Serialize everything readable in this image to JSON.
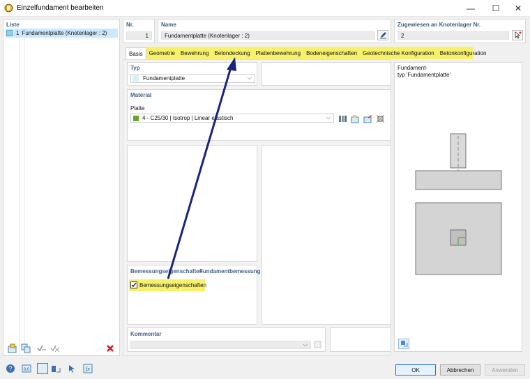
{
  "window": {
    "title": "Einzelfundament bearbeiten",
    "minimize": "—",
    "maximize": "☐",
    "close": "✕"
  },
  "list": {
    "header": "Liste",
    "items": [
      {
        "number": "1",
        "label": "Fundamentplatte (Knotenlager : 2)"
      }
    ]
  },
  "nr": {
    "label": "Nr.",
    "value": "1"
  },
  "name": {
    "label": "Name",
    "value": "Fundamentplatte (Knotenlager : 2)"
  },
  "assigned": {
    "label": "Zugewiesen an Knotenlager Nr.",
    "value": "2"
  },
  "tabs": [
    {
      "label": "Basis"
    },
    {
      "label": "Geometrie"
    },
    {
      "label": "Bewehrung"
    },
    {
      "label": "Betondeckung"
    },
    {
      "label": "Plattenbewehrung"
    },
    {
      "label": "Bodeneigenschaften"
    },
    {
      "label": "Geotechnische Konfiguration"
    },
    {
      "label": "Betonkonfiguration"
    }
  ],
  "typ": {
    "title": "Typ",
    "value": "Fundamentplatte"
  },
  "material": {
    "title": "Material",
    "platte_label": "Platte",
    "value": "4 - C25/30 | Isotrop | Linear elastisch",
    "swatch_color": "#6ba42c"
  },
  "design": {
    "col1": "Bemessungseigenschaften",
    "col2": "Fundamentbemessung",
    "checkbox_label": "Bemessungseigenschaften",
    "checked": true
  },
  "comment": {
    "title": "Kommentar",
    "value": ""
  },
  "preview": {
    "text": "Fundament-\ntyp 'Fundamentplatte'"
  },
  "buttons": {
    "ok": "OK",
    "cancel": "Abbrechen",
    "apply": "Anwenden"
  },
  "colors": {
    "highlight": "#f7f06b",
    "arrow": "#1a237e",
    "accent": "#3a5a82"
  }
}
